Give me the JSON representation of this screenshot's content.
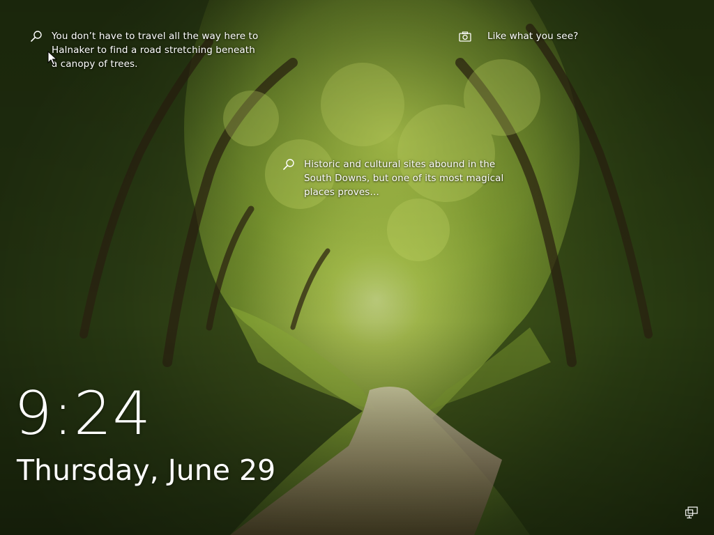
{
  "background": {
    "scene": "tree tunnel over a sunken country lane",
    "colors": {
      "canopy_dark": "#233310",
      "canopy_light": "#a6c24a",
      "light_center": "#e8eeb0",
      "path": "#b9a88c"
    }
  },
  "spotlight": {
    "hotspot_1": "You don’t have to travel all the way here to Halnaker to find a road stretching beneath a canopy of trees.",
    "hotspot_2": "Historic and cultural sites abound in the South Downs, but one of its most magical places proves…",
    "like_label": "Like what you see?",
    "icons": {
      "hotspot": "magnifier-icon",
      "like": "camera-icon",
      "network": "network-icon"
    }
  },
  "lock": {
    "time": "9:24",
    "date": "Thursday, June 29"
  }
}
